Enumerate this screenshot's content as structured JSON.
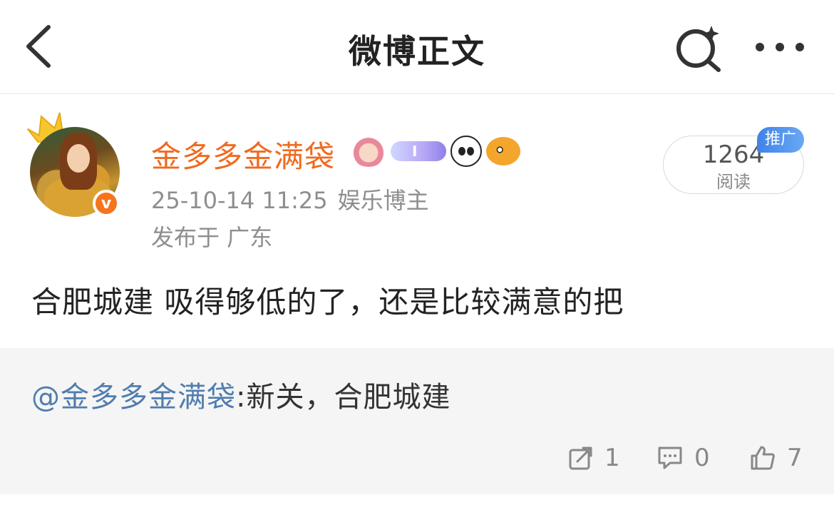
{
  "nav": {
    "title": "微博正文",
    "back_icon": "chevron-left-icon",
    "search_icon": "search-sparkle-icon",
    "more_icon": "more-dots-icon"
  },
  "post": {
    "username": "金多多金满袋",
    "timestamp": "25-10-14 11:25",
    "category": "娱乐博主",
    "location": "发布于 广东",
    "verified_badge": "v",
    "badge_pill_text": "I",
    "read_count": "1264",
    "read_label": "阅读",
    "promo_label": "推广",
    "content": "合肥城建 吸得够低的了，还是比较满意的把",
    "colors": {
      "username": "#f06a1f",
      "verified": "#f4751e",
      "promo": "#3f83e8",
      "mention": "#507daf"
    }
  },
  "retweet": {
    "mention": "@金多多金满袋",
    "text": ":新关，合肥城建",
    "actions": {
      "repost_count": "1",
      "comment_count": "0",
      "like_count": "7"
    }
  }
}
